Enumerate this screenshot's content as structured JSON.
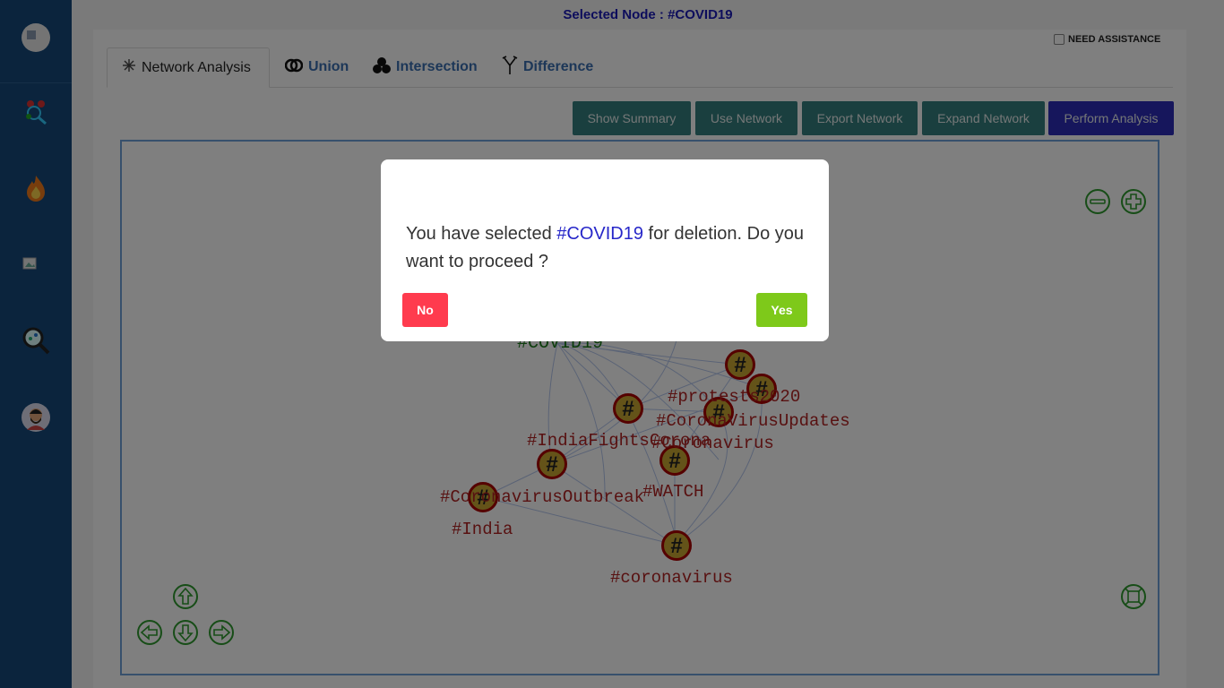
{
  "header": {
    "selected_node": "Selected Node : #COVID19"
  },
  "assistance": {
    "label": "NEED ASSISTANCE",
    "checked": false
  },
  "sidebar": {
    "items": [
      {
        "icon": "avatar-placeholder-icon"
      },
      {
        "icon": "network-search-icon"
      },
      {
        "icon": "trending-fire-icon"
      },
      {
        "icon": "broken-image-icon"
      },
      {
        "icon": "analytics-search-icon"
      },
      {
        "icon": "user-avatar-icon"
      }
    ]
  },
  "tabs": [
    {
      "label": "Network Analysis",
      "icon": "sparkle-icon",
      "active": true
    },
    {
      "label": "Union",
      "icon": "union-rings-icon",
      "active": false
    },
    {
      "label": "Intersection",
      "icon": "intersection-circles-icon",
      "active": false
    },
    {
      "label": "Difference",
      "icon": "fork-icon",
      "active": false
    }
  ],
  "toolbar": {
    "show_summary": "Show Summary",
    "use_network": "Use Network",
    "export_network": "Export Network",
    "expand_network": "Expand Network",
    "perform_analysis": "Perform Analysis"
  },
  "graph": {
    "nodes": [
      {
        "label": "#COVID19"
      },
      {
        "label": "#protests2020"
      },
      {
        "label": "#CoronaVirusUpdates"
      },
      {
        "label": "#IndiaFightsCorona"
      },
      {
        "label": "#Coronavirus"
      },
      {
        "label": "#WATCH"
      },
      {
        "label": "#CoronavirusOutbreak"
      },
      {
        "label": "#India"
      },
      {
        "label": "#coronavirus"
      }
    ]
  },
  "colors": {
    "sidebar": "#17497a",
    "teal_button": "#357e7e",
    "primary_button": "#2d2db8",
    "no_button": "#ff3b4e",
    "yes_button": "#7ec91a",
    "node_label": "#b02222",
    "control_green": "#2e9a2e"
  },
  "modal": {
    "message_before": "You have selected ",
    "node_name": "#COVID19",
    "message_after": " for deletion. Do you want to proceed ?",
    "no_label": "No",
    "yes_label": "Yes"
  }
}
